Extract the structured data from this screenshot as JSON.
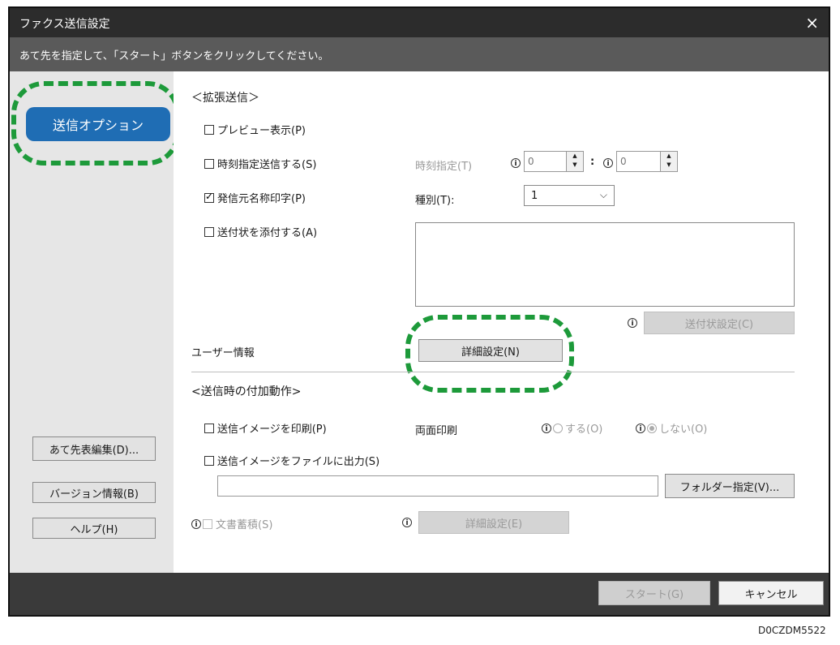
{
  "window": {
    "title": "ファクス送信設定",
    "close_icon": "×"
  },
  "instruction": "あて先を指定して、「スタート」ボタンをクリックしてください。",
  "sidebar": {
    "nav_item": "送信オプション",
    "buttons": {
      "edit_dest": "あて先表編集(D)...",
      "version": "バージョン情報(B)",
      "help": "ヘルプ(H)"
    }
  },
  "extended": {
    "heading": "＜拡張送信＞",
    "preview": "プレビュー表示(P)",
    "timed_send": "時刻指定送信する(S)",
    "time_label": "時刻指定(T)",
    "hour": "0",
    "minute": "0",
    "colon": ":",
    "sender_name": "発信元名称印字(P)",
    "type_label": "種別(T):",
    "type_value": "1",
    "cover_sheet": "送付状を添付する(A)",
    "cover_settings": "送付状設定(C)",
    "user_info": "ユーザー情報",
    "details": "詳細設定(N)"
  },
  "post_send": {
    "heading": "<送信時の付加動作>",
    "print_image": "送信イメージを印刷(P)",
    "duplex_label": "両面印刷",
    "duplex_on": "する(O)",
    "duplex_off": "しない(O)",
    "file_output": "送信イメージをファイルに出力(S)",
    "folder_btn": "フォルダー指定(V)...",
    "doc_storage": "文書蓄積(S)",
    "storage_details": "詳細設定(E)"
  },
  "footer": {
    "start": "スタート(G)",
    "cancel": "キャンセル"
  },
  "figure_code": "D0CZDM5522",
  "colors": {
    "accent": "#1f6db4",
    "highlight": "#1d9a3a",
    "titlebar": "#2c2c2c"
  }
}
